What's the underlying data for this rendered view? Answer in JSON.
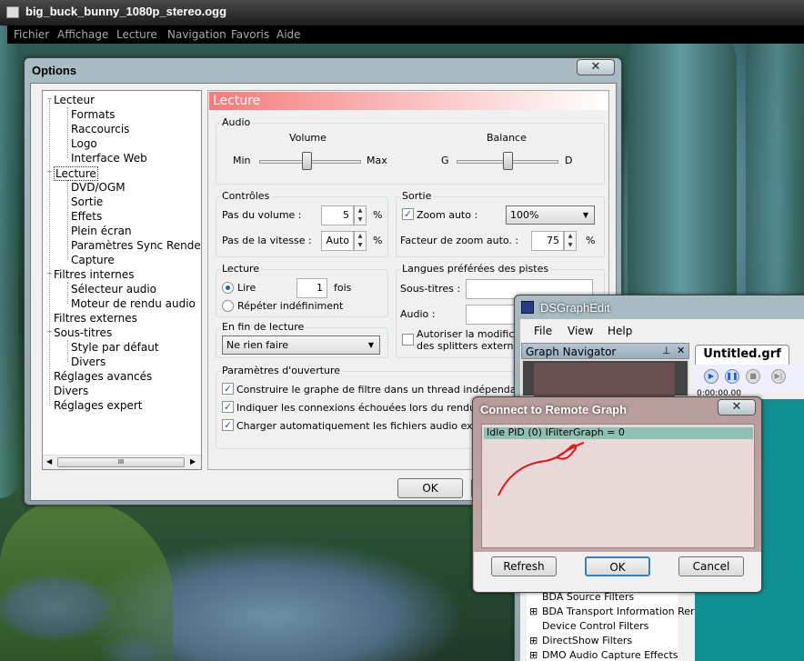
{
  "player": {
    "title": "big_buck_bunny_1080p_stereo.ogg",
    "menu": [
      "Fichier",
      "Affichage",
      "Lecture",
      "Navigation",
      "Favoris",
      "Aide"
    ]
  },
  "options": {
    "title": "Options",
    "close": "✕",
    "tree": [
      {
        "label": "Lecteur",
        "level": 0,
        "expander": "−"
      },
      {
        "label": "Formats",
        "level": 1
      },
      {
        "label": "Raccourcis",
        "level": 1
      },
      {
        "label": "Logo",
        "level": 1
      },
      {
        "label": "Interface Web",
        "level": 1
      },
      {
        "label": "Lecture",
        "level": 0,
        "expander": "−",
        "selected": true
      },
      {
        "label": "DVD/OGM",
        "level": 1
      },
      {
        "label": "Sortie",
        "level": 1
      },
      {
        "label": "Effets",
        "level": 1
      },
      {
        "label": "Plein écran",
        "level": 1
      },
      {
        "label": "Paramètres Sync Rende",
        "level": 1
      },
      {
        "label": "Capture",
        "level": 1
      },
      {
        "label": "Filtres internes",
        "level": 0,
        "expander": "−"
      },
      {
        "label": "Sélecteur audio",
        "level": 1
      },
      {
        "label": "Moteur de rendu audio",
        "level": 1
      },
      {
        "label": "Filtres externes",
        "level": 0
      },
      {
        "label": "Sous-titres",
        "level": 0,
        "expander": "−"
      },
      {
        "label": "Style par défaut",
        "level": 1
      },
      {
        "label": "Divers",
        "level": 1
      },
      {
        "label": "Réglages avancés",
        "level": 0
      },
      {
        "label": "Divers",
        "level": 0
      },
      {
        "label": "Réglages expert",
        "level": 0
      }
    ],
    "page_header": "Lecture",
    "audio": {
      "group": "Audio",
      "volume_label": "Volume",
      "vol_min": "Min",
      "vol_max": "Max",
      "volume_level": 0.6,
      "balance_label": "Balance",
      "bal_left": "G",
      "bal_right": "D",
      "balance_level": 0.5
    },
    "controles": {
      "group": "Contrôles",
      "pas_volume_label": "Pas du volume :",
      "pas_volume_value": "5",
      "pas_volume_unit": "%",
      "pas_vitesse_label": "Pas de la vitesse :",
      "pas_vitesse_value": "Auto",
      "pas_vitesse_unit": "%"
    },
    "sortie": {
      "group": "Sortie",
      "zoom_auto_label": "Zoom auto :",
      "zoom_auto_value": "100%",
      "facteur_label": "Facteur de zoom auto. :",
      "facteur_value": "75",
      "facteur_unit": "%"
    },
    "lecture": {
      "group": "Lecture",
      "lire_label": "Lire",
      "lire_value": "1",
      "fois": "fois",
      "repeter_label": "Répéter indéfiniment"
    },
    "langues": {
      "group": "Langues préférées des pistes",
      "soustitres_label": "Sous-titres :",
      "audio_label": "Audio :",
      "autoriser_line1": "Autoriser la modification",
      "autoriser_line2": "des splitters externes"
    },
    "fin": {
      "group": "En fin de lecture",
      "value": "Ne rien faire"
    },
    "ouverture": {
      "group": "Paramètres d'ouverture",
      "opt1": "Construire le graphe de filtre dans un thread indépendant",
      "opt2": "Indiquer les connexions échouées lors du rendu",
      "opt3": "Charger automatiquement les fichiers audio externes"
    },
    "ok": "OK",
    "scroll_grip": "III",
    "scroll_left": "◀",
    "scroll_right": "▶"
  },
  "dsgraph": {
    "title": "DSGraphEdit",
    "menu": [
      "File",
      "View",
      "Help"
    ],
    "navigator": "Graph Navigator",
    "pin": "⊥",
    "close": "✕",
    "tab": "Untitled.grf",
    "time": "0:00:00.00",
    "filters": [
      "BDA Source Filters",
      "BDA Transport Information Rer",
      "Device Control Filters",
      "DirectShow Filters",
      "DMO Audio Capture Effects"
    ]
  },
  "connect": {
    "title": "Connect to Remote Graph",
    "close": "✕",
    "item": "Idle PID (0) IFilterGraph = 0",
    "refresh": "Refresh",
    "ok": "OK",
    "cancel": "Cancel"
  }
}
